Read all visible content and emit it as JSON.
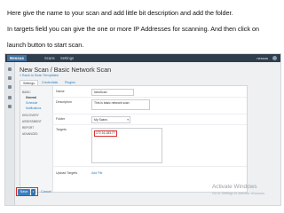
{
  "instructions": [
    "Here give the name to your scan and add little bit description and add the folder.",
    "In targets field you can give the one or more IP Addresses for scanning. And then click on",
    "launch button to start scan."
  ],
  "app": {
    "logo": "Nessus",
    "nav": [
      "Scans",
      "Settings"
    ],
    "user": "nessus"
  },
  "page": {
    "title": "New Scan / Basic Network Scan",
    "back_link": "« Back to Scan Templates",
    "tabs": [
      "Settings",
      "Credentials",
      "Plugins"
    ]
  },
  "left_nav": [
    {
      "label": "BASIC",
      "type": "section"
    },
    {
      "label": "General",
      "type": "current"
    },
    {
      "label": "Schedule",
      "type": "sub"
    },
    {
      "label": "Notifications",
      "type": "sub"
    },
    {
      "label": "DISCOVERY",
      "type": "section"
    },
    {
      "label": "ASSESSMENT",
      "type": "section"
    },
    {
      "label": "REPORT",
      "type": "section"
    },
    {
      "label": "ADVANCED",
      "type": "section"
    }
  ],
  "form": {
    "name_label": "Name",
    "name_value": "NewScan",
    "description_label": "Description",
    "description_value": "This is basic network scan",
    "folder_label": "Folder",
    "folder_value": "My Scans",
    "targets_label": "Targets",
    "targets_value": "172.16.183.77",
    "upload_label": "Upload Targets",
    "add_file": "Add File"
  },
  "actions": {
    "save": "Save",
    "cancel": "Cancel"
  },
  "watermark": {
    "line1": "Activate Windows",
    "line2": "Go to Settings to activate Windows."
  },
  "colors": {
    "highlight": "#d62828",
    "accent": "#3f7fbf",
    "topbar": "#2f3d4c"
  }
}
